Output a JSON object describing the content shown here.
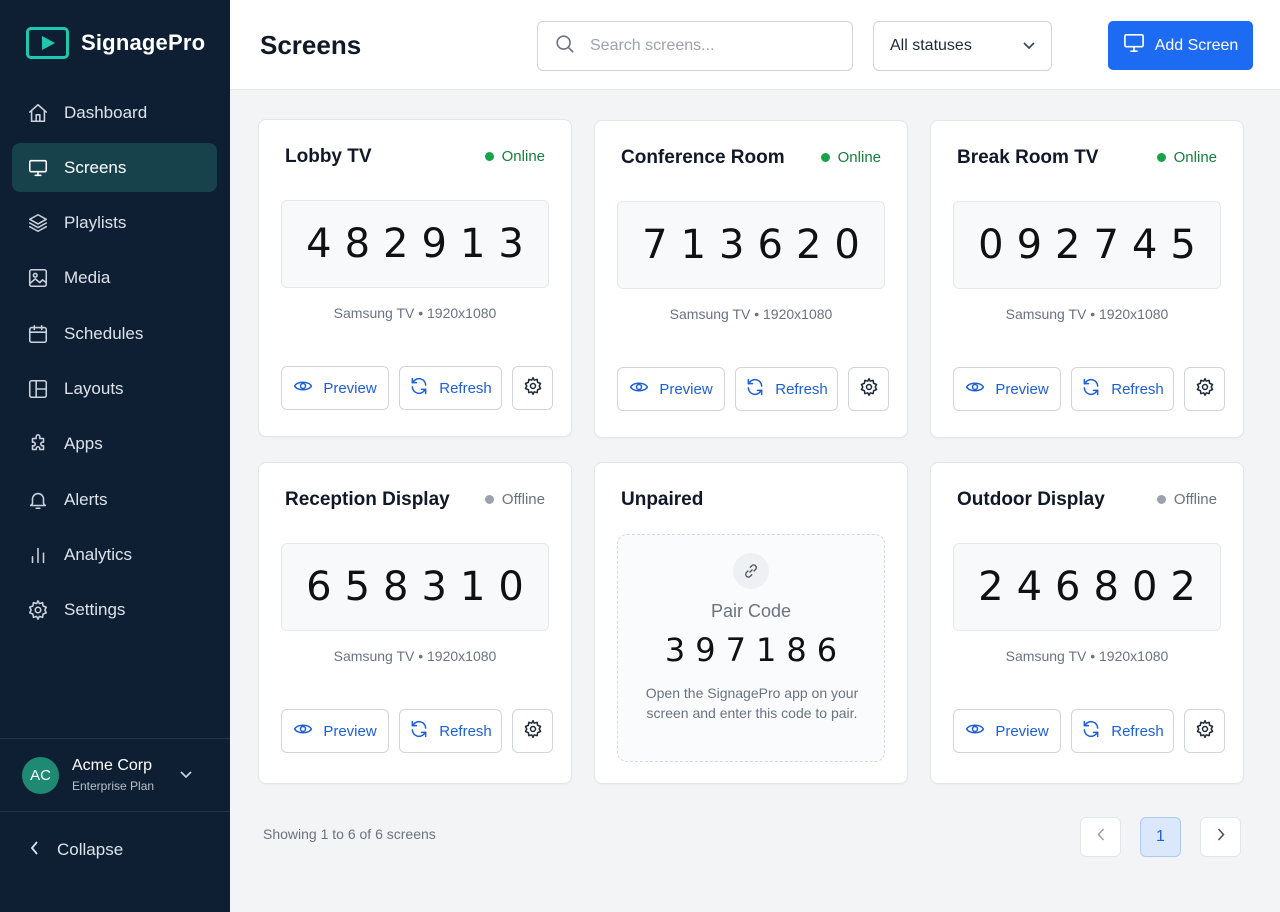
{
  "brand": {
    "name": "SignagePro"
  },
  "sidebar": {
    "items": [
      {
        "label": "Dashboard",
        "icon": "home-icon"
      },
      {
        "label": "Screens",
        "icon": "monitor-icon",
        "active": true
      },
      {
        "label": "Playlists",
        "icon": "layers-icon"
      },
      {
        "label": "Media",
        "icon": "image-icon"
      },
      {
        "label": "Schedules",
        "icon": "calendar-icon"
      },
      {
        "label": "Layouts",
        "icon": "layout-icon"
      },
      {
        "label": "Apps",
        "icon": "puzzle-icon"
      },
      {
        "label": "Alerts",
        "icon": "bell-icon"
      },
      {
        "label": "Analytics",
        "icon": "bar-chart-icon"
      },
      {
        "label": "Settings",
        "icon": "gear-icon"
      }
    ],
    "account": {
      "initials": "AC",
      "name": "Acme Corp",
      "plan": "Enterprise Plan"
    },
    "collapse_label": "Collapse"
  },
  "header": {
    "title": "Screens",
    "search_placeholder": "Search screens...",
    "status_filter": "All statuses",
    "add_button": "Add Screen"
  },
  "cards": [
    {
      "name": "Lobby TV",
      "status": "Online",
      "code": "482913",
      "device": "Samsung TV • 1920x1080"
    },
    {
      "name": "Conference Room",
      "status": "Online",
      "code": "713620",
      "device": "Samsung TV • 1920x1080"
    },
    {
      "name": "Break Room TV",
      "status": "Online",
      "code": "092745",
      "device": "Samsung TV • 1920x1080"
    },
    {
      "name": "Reception Display",
      "status": "Offline",
      "code": "658310",
      "device": "Samsung TV • 1920x1080"
    },
    {
      "name": "Outdoor Display",
      "status": "Offline",
      "code": "246802",
      "device": "Samsung TV • 1920x1080"
    }
  ],
  "unpaired": {
    "title": "Unpaired",
    "pair_label": "Pair Code",
    "pair_code": "397186",
    "help": "Open the SignagePro app on your screen and enter this code to pair."
  },
  "actions": {
    "preview": "Preview",
    "refresh": "Refresh"
  },
  "pagination": {
    "summary": "Showing 1 to 6 of 6 screens",
    "current_page": "1"
  },
  "colors": {
    "sidebar_bg": "#0f1f33",
    "accent": "#1d6bf3",
    "online": "#16a34a",
    "offline": "#9ca3af",
    "brand_teal": "#1ec8b0"
  }
}
